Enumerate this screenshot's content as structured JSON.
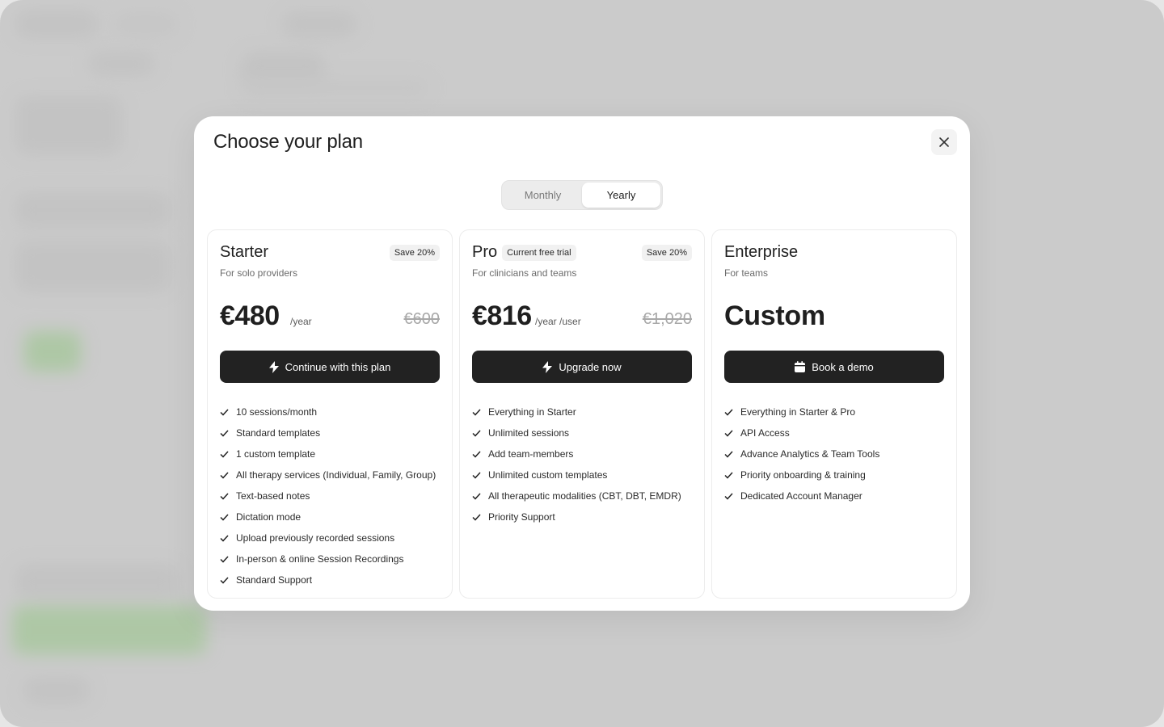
{
  "modal": {
    "title": "Choose your plan"
  },
  "billing_toggle": {
    "options": [
      "Monthly",
      "Yearly"
    ],
    "selected": "Yearly"
  },
  "plans": [
    {
      "name": "Starter",
      "badge": "",
      "save_tag": "Save 20%",
      "subtitle": "For solo providers",
      "price": "€480",
      "period": "/year",
      "old_price": "€600",
      "cta": "Continue with this plan",
      "cta_icon": "lightning-icon",
      "features": [
        "10 sessions/month",
        "Standard templates",
        "1 custom template",
        "All therapy services (Individual, Family, Group)",
        "Text-based notes",
        "Dictation mode",
        "Upload previously recorded sessions",
        "In-person & online Session Recordings",
        "Standard Support"
      ]
    },
    {
      "name": "Pro",
      "badge": "Current free trial",
      "save_tag": "Save 20%",
      "subtitle": "For clinicians and teams",
      "price": "€816",
      "period": "/year /user",
      "old_price": "€1,020",
      "cta": "Upgrade now",
      "cta_icon": "lightning-icon",
      "features": [
        "Everything in Starter",
        "Unlimited sessions",
        "Add team-members",
        "Unlimited custom templates",
        "All therapeutic modalities (CBT, DBT, EMDR)",
        "Priority Support"
      ]
    },
    {
      "name": "Enterprise",
      "badge": "",
      "save_tag": "",
      "subtitle": "For teams",
      "price": "Custom",
      "period": "",
      "old_price": "",
      "cta": "Book a demo",
      "cta_icon": "calendar-icon",
      "features": [
        "Everything in Starter & Pro",
        "API Access",
        "Advance Analytics & Team Tools",
        "Priority onboarding & training",
        "Dedicated Account Manager"
      ]
    }
  ],
  "colors": {
    "button_bg": "#222222",
    "modal_bg": "#ffffff",
    "overlay": "#d4d4d4"
  }
}
